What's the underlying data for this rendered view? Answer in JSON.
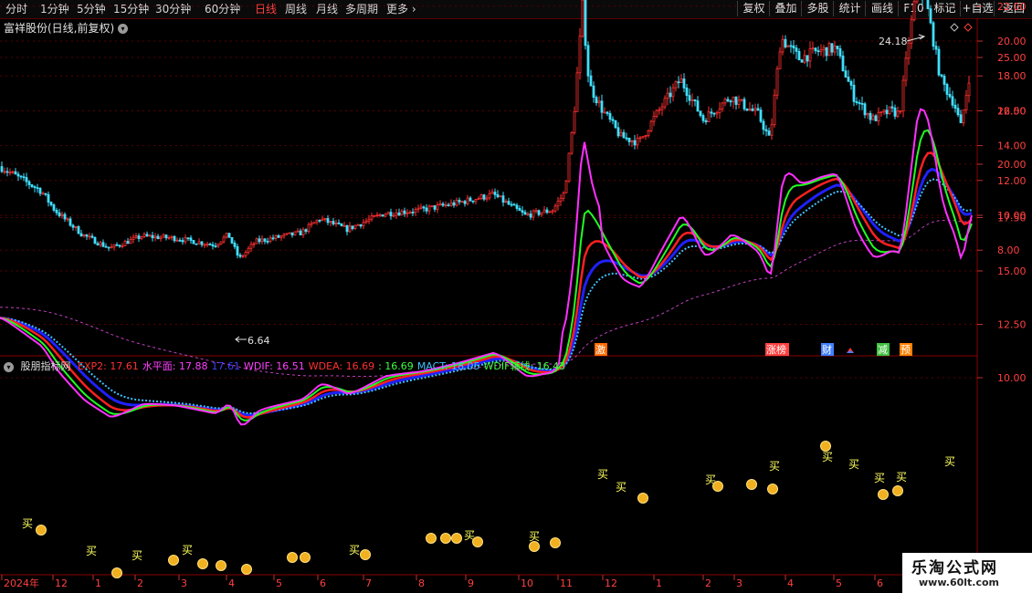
{
  "toolbar": {
    "timeframes": [
      "分时",
      "1分钟",
      "5分钟",
      "15分钟",
      "30分钟",
      "60分钟",
      "日线",
      "周线",
      "月线",
      "多周期",
      "更多"
    ],
    "active": "日线",
    "right_buttons": [
      "复权",
      "叠加",
      "多股",
      "统计",
      "画线",
      "F10",
      "标记",
      "+自选",
      "返回"
    ]
  },
  "chart_title": "富祥股份(日线,前复权)",
  "price_axis": {
    "ticks": [
      "24.00",
      "22.00",
      "20.00",
      "18.00",
      "16.00",
      "14.00",
      "12.00",
      "10.00",
      "8.00"
    ]
  },
  "annotations": {
    "high": "24.18",
    "low": "6.64"
  },
  "event_tags": [
    "激",
    "涨榜",
    "财",
    "减",
    "预"
  ],
  "indicator": {
    "name": "股朋指标网",
    "values": [
      {
        "label": "EXP2: 17.61",
        "color": "#ff3030"
      },
      {
        "label": "水平面: 17.88",
        "color": "#ff40ff"
      },
      {
        "label": "17.61",
        "color": "#4040ff"
      },
      {
        "label": "WDIF: 16.51",
        "color": "#ff40ff"
      },
      {
        "label": "WDEA: 16.69",
        "color": "#ff3030"
      },
      {
        "label": ": 16.69",
        "color": "#40ff40"
      },
      {
        "label": "MACT: 18.05",
        "color": "#40c0ff"
      },
      {
        "label": "WDIF辅线: 16.43",
        "color": "#40ff40"
      }
    ]
  },
  "indicator_axis": {
    "ticks": [
      "25.00",
      "22.50",
      "20.00",
      "17.50",
      "15.00",
      "12.50",
      "10.00"
    ]
  },
  "buy_label": "买",
  "time_axis": [
    "2024年",
    "12",
    "1",
    "2",
    "3",
    "4",
    "5",
    "6",
    "7",
    "8",
    "9",
    "10",
    "11",
    "12",
    "1",
    "2",
    "3",
    "4",
    "5",
    "6"
  ],
  "watermark": {
    "name": "乐淘公式网",
    "url": "www.60lt.com"
  }
}
